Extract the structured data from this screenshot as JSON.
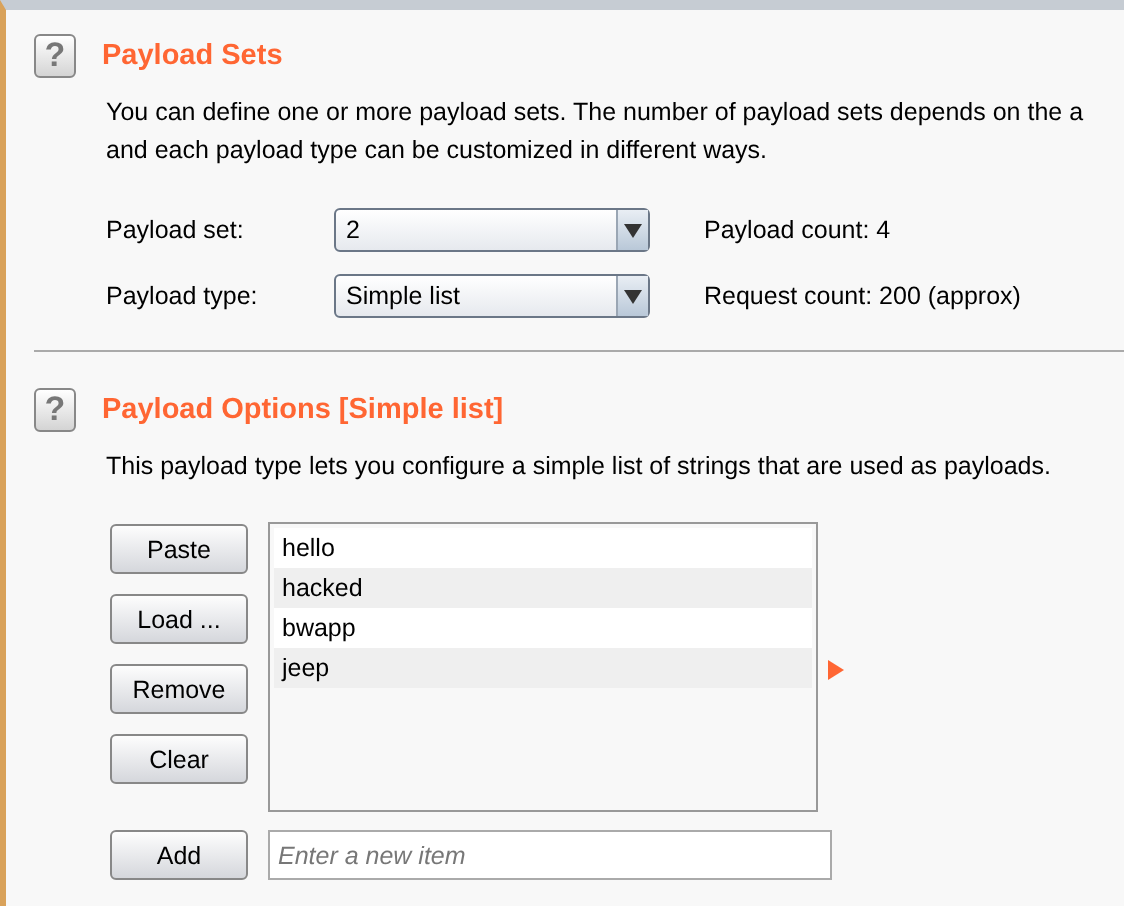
{
  "payload_sets": {
    "help": "?",
    "title": "Payload Sets",
    "description": [
      "You can define one or more payload sets. The number of payload sets depends on the a",
      "and each payload type can be customized in different ways."
    ],
    "fields": [
      {
        "label": "Payload set:",
        "value": "2",
        "info_label": "Payload count:",
        "info_value": "4"
      },
      {
        "label": "Payload type:",
        "value": "Simple list",
        "info_label": "Request count:",
        "info_value": "200 (approx)"
      }
    ]
  },
  "payload_options": {
    "help": "?",
    "title": "Payload Options [Simple list]",
    "description": "This payload type lets you configure a simple list of strings that are used as payloads.",
    "buttons": [
      "Paste",
      "Load ...",
      "Remove",
      "Clear"
    ],
    "items": [
      "hello",
      "hacked",
      "bwapp",
      "jeep"
    ],
    "add_button": "Add",
    "add_field": {
      "placeholder": "Enter a new item"
    }
  }
}
